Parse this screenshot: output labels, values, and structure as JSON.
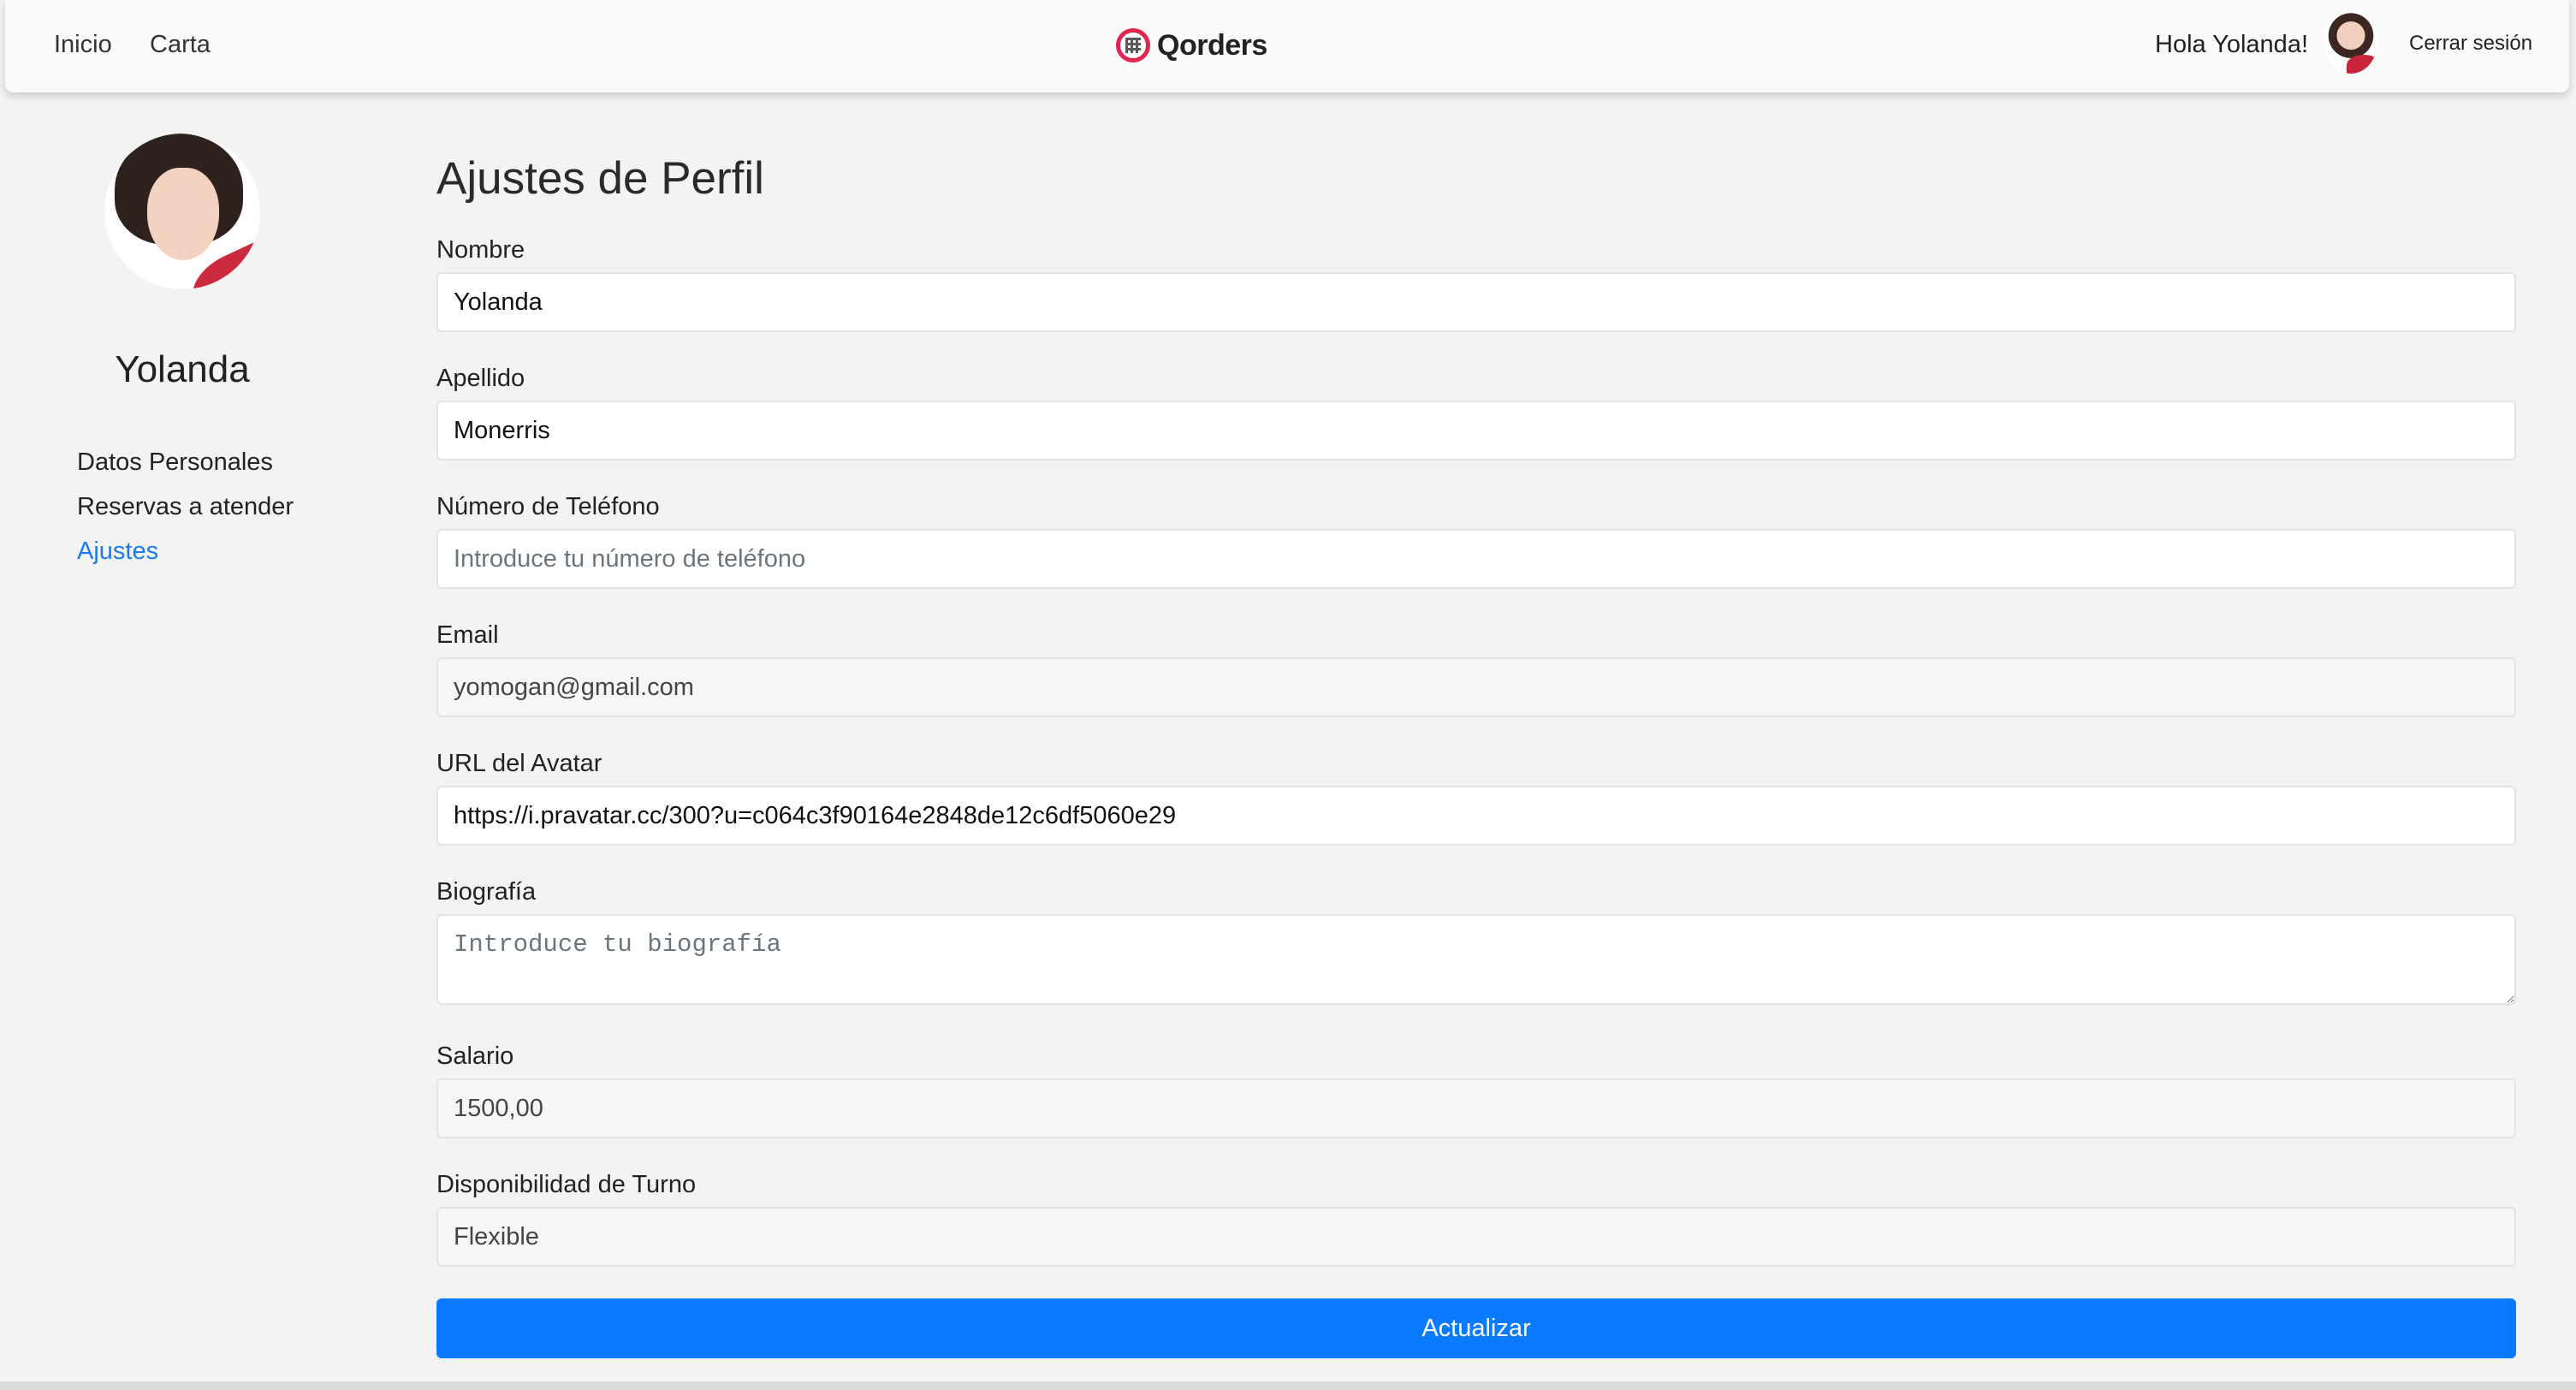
{
  "navbar": {
    "links": [
      "Inicio",
      "Carta"
    ],
    "brand": "Qorders",
    "greeting": "Hola Yolanda!",
    "logout": "Cerrar sesión",
    "brand_color": "#e0264e"
  },
  "sidebar": {
    "name": "Yolanda",
    "items": [
      {
        "label": "Datos Personales",
        "active": false
      },
      {
        "label": "Reservas a atender",
        "active": false
      },
      {
        "label": "Ajustes",
        "active": true
      }
    ],
    "active_color": "#1a7cf0"
  },
  "form": {
    "title": "Ajustes de Perfil",
    "nombre": {
      "label": "Nombre",
      "value": "Yolanda"
    },
    "apellido": {
      "label": "Apellido",
      "value": "Monerris"
    },
    "telefono": {
      "label": "Número de Teléfono",
      "value": "",
      "placeholder": "Introduce tu número de teléfono"
    },
    "email": {
      "label": "Email",
      "value": "yomogan@gmail.com"
    },
    "avatar_url": {
      "label": "URL del Avatar",
      "value": "https://i.pravatar.cc/300?u=c064c3f90164e2848de12c6df5060e29"
    },
    "biografia": {
      "label": "Biografía",
      "value": "",
      "placeholder": "Introduce tu biografía"
    },
    "salario": {
      "label": "Salario",
      "value": "1500,00"
    },
    "turno": {
      "label": "Disponibilidad de Turno",
      "value": "Flexible"
    },
    "submit_label": "Actualizar",
    "submit_color": "#0a7bff"
  }
}
